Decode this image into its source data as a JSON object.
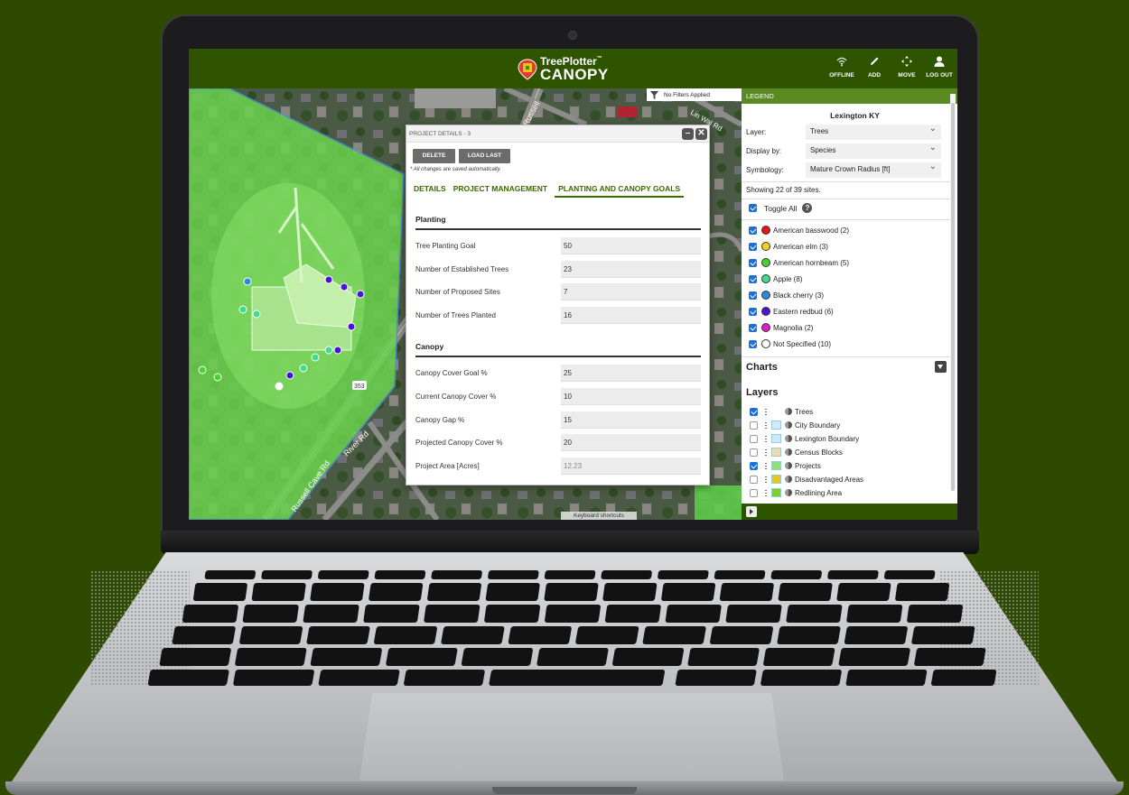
{
  "app": {
    "logo_line1": "TreePlotter",
    "logo_tm": "™",
    "logo_line2": "CANOPY",
    "nav": [
      {
        "label": "OFFLINE",
        "icon": "wifi-icon"
      },
      {
        "label": "ADD",
        "icon": "pencil-icon"
      },
      {
        "label": "MOVE",
        "icon": "move-arrows-icon"
      },
      {
        "label": "LOG OUT",
        "icon": "user-icon"
      }
    ],
    "colors": {
      "topbar": "#2e5400",
      "accent": "#3b6a00",
      "legend_header": "#5a8a22",
      "background": "#2d4a00"
    }
  },
  "map": {
    "filter_label": "No Filters Applied",
    "road_labels": [
      "Russell Cave Rd",
      "River Rd",
      "Russell",
      "Lin Wal Rd",
      "353"
    ],
    "keyboard_shortcuts": "Keyboard shortcuts"
  },
  "project_panel": {
    "title": "PROJECT DETAILS - 3",
    "delete_label": "DELETE",
    "load_last_label": "LOAD LAST",
    "autosave_note": "* All changes are saved automatically.",
    "tabs": [
      {
        "label": "DETAILS",
        "active": false
      },
      {
        "label": "PROJECT MANAGEMENT",
        "active": false
      },
      {
        "label": "PLANTING AND CANOPY GOALS",
        "active": true
      }
    ],
    "planting": {
      "title": "Planting",
      "rows": [
        {
          "label": "Tree Planting Goal",
          "value": "50"
        },
        {
          "label": "Number of Established Trees",
          "value": "23"
        },
        {
          "label": "Number of Proposed Sites",
          "value": "7"
        },
        {
          "label": "Number of Trees Planted",
          "value": "16"
        }
      ]
    },
    "canopy": {
      "title": "Canopy",
      "rows": [
        {
          "label": "Canopy Cover Goal %",
          "value": "25"
        },
        {
          "label": "Current Canopy Cover %",
          "value": "10"
        },
        {
          "label": "Canopy Gap %",
          "value": "15"
        },
        {
          "label": "Projected Canopy Cover %",
          "value": "20"
        },
        {
          "label": "Project Area [Acres]",
          "value": "12.23"
        }
      ]
    }
  },
  "legend": {
    "header": "LEGEND",
    "city": "Lexington KY",
    "layer_label": "Layer:",
    "layer_value": "Trees",
    "display_label": "Display by:",
    "display_value": "Species",
    "symbology_label": "Symbology:",
    "symbology_value": "Mature Crown Radius [ft]",
    "showing": "Showing 22 of 39 sites.",
    "toggle_all": "Toggle All",
    "species": [
      {
        "label": "American basswood (2)",
        "color": "#e8141b"
      },
      {
        "label": "American elm (3)",
        "color": "#f2d21a"
      },
      {
        "label": "American hornbeam (5)",
        "color": "#45d428"
      },
      {
        "label": "Apple (8)",
        "color": "#3fdc8a"
      },
      {
        "label": "Black cherry (3)",
        "color": "#2f87e0"
      },
      {
        "label": "Eastern redbud (6)",
        "color": "#4a12d6"
      },
      {
        "label": "Magnolia (2)",
        "color": "#e21ccd"
      },
      {
        "label": "Not Specified (10)",
        "color": "#ffffff"
      }
    ],
    "charts_title": "Charts",
    "layers_title": "Layers",
    "layers": [
      {
        "label": "Trees",
        "checked": true,
        "swatch": ""
      },
      {
        "label": "City Boundary",
        "checked": false,
        "swatch": "#cfe8ff"
      },
      {
        "label": "Lexington Boundary",
        "checked": false,
        "swatch": "#cfe8ff"
      },
      {
        "label": "Census Blocks",
        "checked": false,
        "swatch": "#f7d7b0"
      },
      {
        "label": "Projects",
        "checked": true,
        "swatch": "#8fe07a"
      },
      {
        "label": "Disadvantaged Areas",
        "checked": false,
        "swatch": "#e8c61e"
      },
      {
        "label": "Redlining Area",
        "checked": false,
        "swatch": "#7bd327"
      }
    ]
  }
}
